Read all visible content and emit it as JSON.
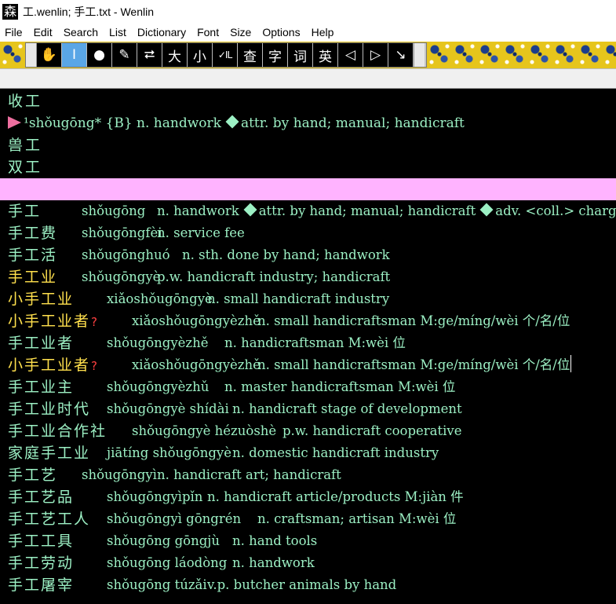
{
  "window": {
    "icon_glyph": "森",
    "title": "工.wenlin; 手工.txt - Wenlin"
  },
  "menu": [
    "File",
    "Edit",
    "Search",
    "List",
    "Dictionary",
    "Font",
    "Size",
    "Options",
    "Help"
  ],
  "toolbar": {
    "buttons": [
      {
        "glyph": "✋",
        "icon": "hand-icon"
      },
      {
        "glyph": "I",
        "icon": "text-cursor-icon"
      },
      {
        "glyph": "●",
        "icon": "circle-icon"
      },
      {
        "glyph": "✎",
        "icon": "pen-icon"
      },
      {
        "glyph": "⮂",
        "icon": "arrows-icon"
      },
      {
        "glyph": "大",
        "icon": "big-char-icon"
      },
      {
        "glyph": "小",
        "icon": "small-char-icon"
      },
      {
        "glyph": "✓IL",
        "icon": "check-il-icon"
      },
      {
        "glyph": "查",
        "icon": "lookup-char-icon"
      },
      {
        "glyph": "字",
        "icon": "character-icon"
      },
      {
        "glyph": "词",
        "icon": "word-icon"
      },
      {
        "glyph": "英",
        "icon": "english-icon"
      },
      {
        "glyph": "◁",
        "icon": "back-icon"
      },
      {
        "glyph": "▷",
        "icon": "forward-icon"
      },
      {
        "glyph": "↘",
        "icon": "arrow-down-right-icon"
      }
    ]
  },
  "colors": {
    "accent_green": "#9cf0c4",
    "highlight_yellow": "#ffe04d",
    "divider_pink": "#ffb3ff",
    "toolbar_active": "#5aa6e6"
  },
  "upper": {
    "line1": "收工",
    "entry": {
      "pinyin": "¹shǒugōng* {B} n. handwork",
      "def2": "attr. by hand; manual; handicraft"
    },
    "line3": "兽工",
    "line4": "双工"
  },
  "entries": [
    {
      "hw": "手工",
      "py": "shǒugōng",
      "def": "n. handwork",
      "def2": "attr. by hand; manual; handicraft",
      "def3": "adv. <coll.> charge"
    },
    {
      "hw": "手工费",
      "py": "shǒugōngfèi",
      "def": "n. service fee"
    },
    {
      "hw": "手工活",
      "py": "shǒugōnghuó",
      "def": "n. sth. done by hand; handwork"
    },
    {
      "hw": "手工业",
      "py": "shǒugōngyè",
      "def": "p.w. handicraft industry; handicraft",
      "yellow": true
    },
    {
      "hw": "小手工业",
      "py": "xiǎoshǒugōngyè",
      "def": "n. small handicraft industry",
      "yellow": true
    },
    {
      "hw": "小手工业者",
      "q": "?",
      "py": "xiǎoshǒugōngyèzhě",
      "def": "n. small handicraftsman M:ge/míng/wèi 个/名/位",
      "yellow": true
    },
    {
      "hw": "手工业者",
      "py": "shǒugōngyèzhě",
      "def": "n. handicraftsman M:wèi 位"
    },
    {
      "hw": "小手工业者",
      "q": "?",
      "py": "xiǎoshǒugōngyèzhě",
      "def": "n. small handicraftsman M:ge/míng/wèi 个/名/位",
      "yellow": true
    },
    {
      "hw": "手工业主",
      "py": "shǒugōngyèzhǔ",
      "def": "n. master handicraftsman M:wèi 位"
    },
    {
      "hw": "手工业时代",
      "py": "shǒugōngyè shídài",
      "def": "n. handicraft stage of development"
    },
    {
      "hw": "手工业合作社",
      "py": "shǒugōngyè hézuòshè",
      "def": "p.w. handicraft cooperative"
    },
    {
      "hw": "家庭手工业",
      "py": "jiātíng shǒugōngyè",
      "def": "n. domestic handicraft industry"
    },
    {
      "hw": "手工艺",
      "py": "shǒugōngyì",
      "def": "n. handicraft art; handicraft"
    },
    {
      "hw": "手工艺品",
      "py": "shǒugōngyìpǐn",
      "def": "n. handicraft article/products M:jiàn 件"
    },
    {
      "hw": "手工艺工人",
      "py": "shǒugōngyì gōngrén",
      "def": "n. craftsman; artisan M:wèi 位"
    },
    {
      "hw": "手工工具",
      "py": "shǒugōng gōngjù",
      "def": "n. hand tools"
    },
    {
      "hw": "手工劳动",
      "py": "shǒugōng láodòng",
      "def": "n. handwork"
    },
    {
      "hw": "手工屠宰",
      "py": "shǒugōng túzǎi",
      "def": "v.p. butcher animals by hand"
    }
  ]
}
